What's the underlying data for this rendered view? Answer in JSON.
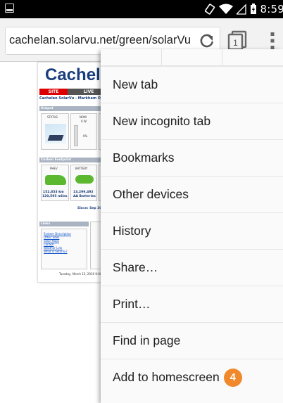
{
  "status_bar": {
    "time": "8:59",
    "left_icon": "image-notification-icon",
    "icons": [
      "rotation-icon",
      "wifi-icon",
      "signal-icon",
      "battery-icon"
    ]
  },
  "toolbar": {
    "url": "cachelan.solarvu.net/green/solarVu",
    "tab_count": "1",
    "reload_icon": "reload-icon",
    "menu_icon": "overflow-menu-icon"
  },
  "page": {
    "logo": "Cachelan",
    "nav_site": "SITE",
    "nav_live": "LIVE",
    "site_title": "Cachelan SolarVu - Markham ON",
    "output_label": "Output",
    "status_label": "STATUS",
    "now_label": "NOW",
    "now_value": "0 W",
    "percent": "0%",
    "footprint_label": "Carbon Footprint",
    "phev_label": "PHEV",
    "battery_label": "BATTERY",
    "phev_value": "152,853 km",
    "phev_value2": "120,595 miles",
    "battery_value": "13,299,492",
    "battery_value2": "AA Batteries",
    "since": "Since: Sep 30, 20",
    "links_label": "Links",
    "links": [
      "System Description",
      "Other Sites",
      "Solar Maps",
      "CanSIA",
      "Weather Link",
      "What is SolarVu?"
    ],
    "footer_date": "Tuesday, March 15, 2016 9:00:02"
  },
  "menu": {
    "items": [
      {
        "label": "New tab"
      },
      {
        "label": "New incognito tab"
      },
      {
        "label": "Bookmarks"
      },
      {
        "label": "Other devices"
      },
      {
        "label": "History"
      },
      {
        "label": "Share…"
      },
      {
        "label": "Print…"
      },
      {
        "label": "Find in page"
      },
      {
        "label": "Add to homescreen",
        "badge": "4"
      }
    ]
  },
  "colors": {
    "badge": "#f0892b",
    "logo": "#1a3e7c",
    "nav_red": "#dd0000"
  }
}
